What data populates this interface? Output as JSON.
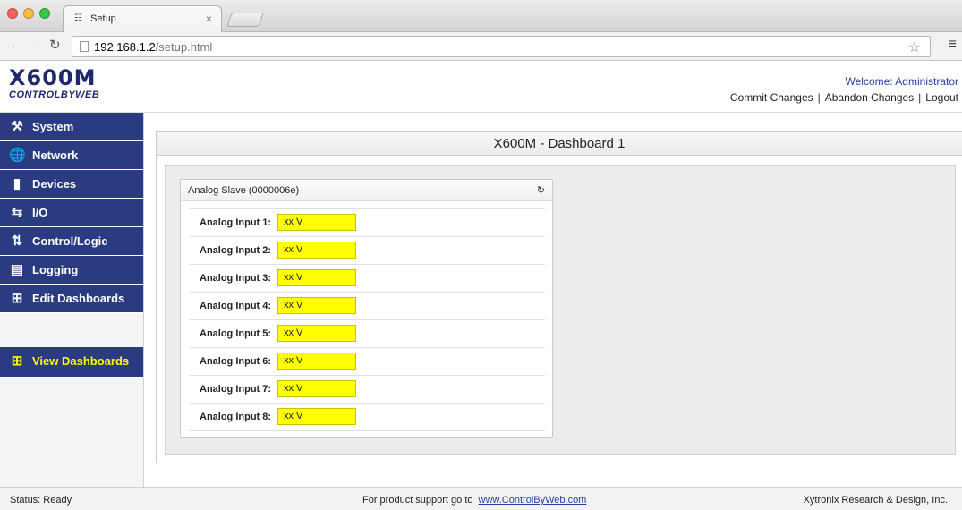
{
  "browser": {
    "tab_title": "Setup",
    "tab_favicon": "network-icon",
    "url_host": "192.168.1.2",
    "url_path": "/setup.html"
  },
  "header": {
    "logo_main": "X600M",
    "logo_sub": "CONTROLBYWEB",
    "welcome": "Welcome: Administrator",
    "commit_changes": "Commit Changes",
    "abandon_changes": "Abandon Changes",
    "logout": "Logout",
    "separator": "|"
  },
  "sidebar": {
    "items": [
      {
        "label": "System",
        "icon": "wrench-icon"
      },
      {
        "label": "Network",
        "icon": "globe-icon"
      },
      {
        "label": "Devices",
        "icon": "device-icon"
      },
      {
        "label": "I/O",
        "icon": "arrows-icon"
      },
      {
        "label": "Control/Logic",
        "icon": "control-logic-icon"
      },
      {
        "label": "Logging",
        "icon": "logging-icon"
      },
      {
        "label": "Edit Dashboards",
        "icon": "dashboard-icon"
      }
    ],
    "view_dashboards": {
      "label": "View Dashboards",
      "icon": "dashboard-icon"
    },
    "accent_color": "#ffff00",
    "item_bg": "#2b3b81"
  },
  "dashboard": {
    "title": "X600M - Dashboard 1",
    "panel": {
      "title": "Analog Slave (0000006e)",
      "refresh_icon": "refresh-icon",
      "rows": [
        {
          "label": "Analog Input 1:",
          "value": "xx V"
        },
        {
          "label": "Analog Input 2:",
          "value": "xx V"
        },
        {
          "label": "Analog Input 3:",
          "value": "xx V"
        },
        {
          "label": "Analog Input 4:",
          "value": "xx V"
        },
        {
          "label": "Analog Input 5:",
          "value": "xx V"
        },
        {
          "label": "Analog Input 6:",
          "value": "xx V"
        },
        {
          "label": "Analog Input 7:",
          "value": "xx V"
        },
        {
          "label": "Analog Input 8:",
          "value": "xx V"
        }
      ]
    }
  },
  "status_bar": {
    "status": "Status:  Ready",
    "support_text": "For product support go to",
    "support_link": "www.ControlByWeb.com",
    "company": "Xytronix Research & Design, Inc."
  }
}
